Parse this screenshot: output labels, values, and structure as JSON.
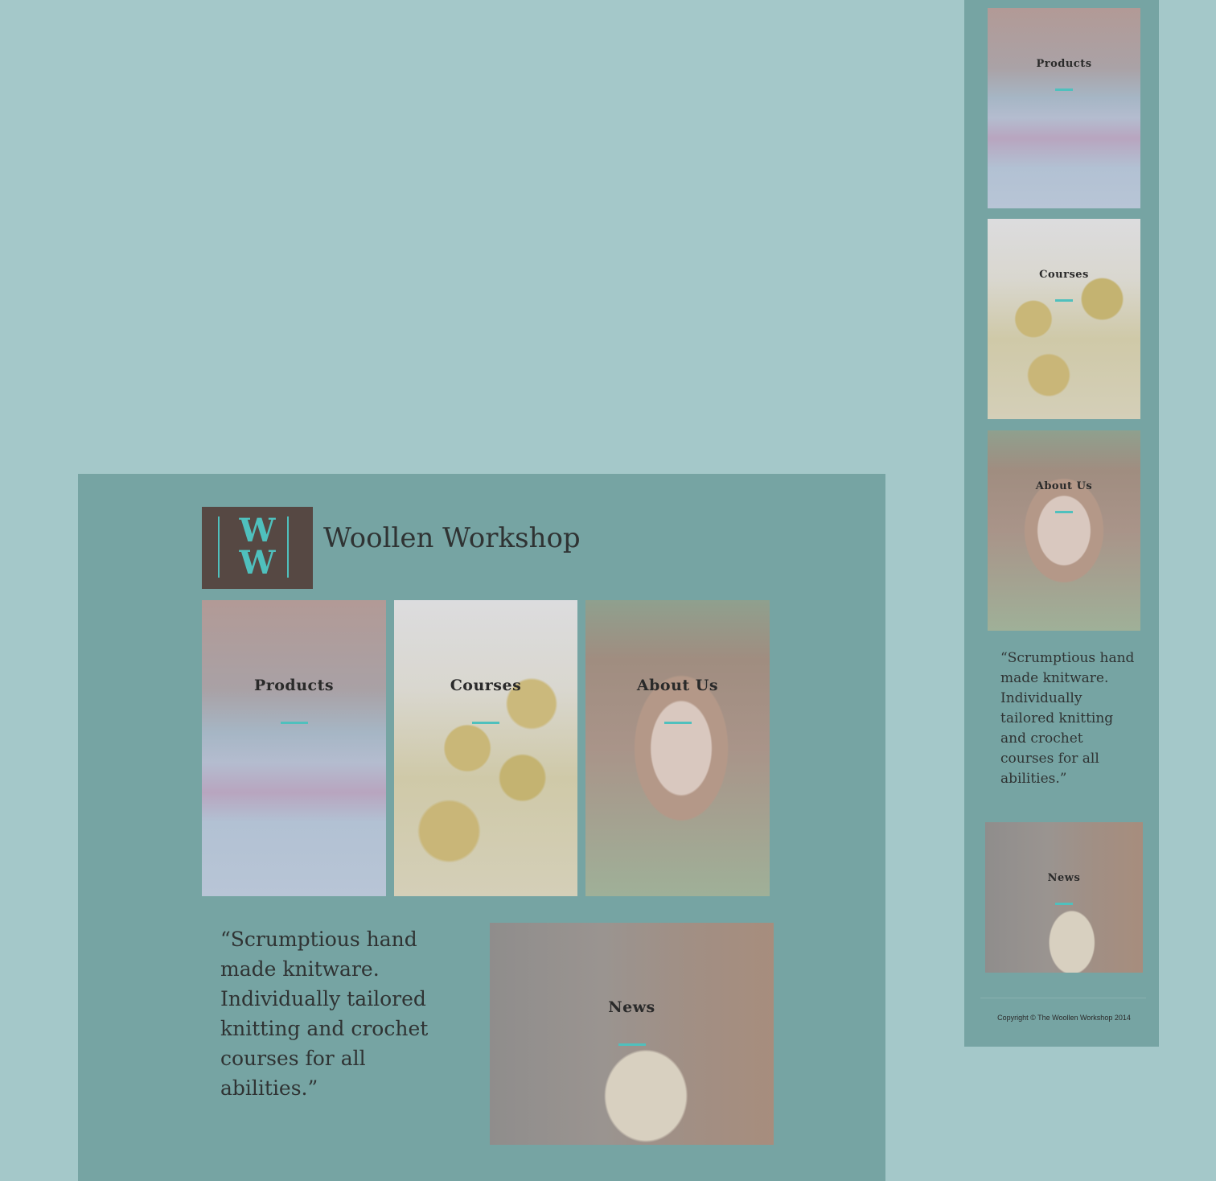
{
  "site": {
    "title": "Woollen Workshop",
    "logo_letters": [
      "W",
      "W"
    ]
  },
  "nav_tiles": [
    {
      "label": "Products"
    },
    {
      "label": "Courses"
    },
    {
      "label": "About Us"
    },
    {
      "label": "News"
    }
  ],
  "quote": "“Scrumptious hand made knitware. Individually tailored knitting and crochet courses for all abilities.”",
  "footer": {
    "copyright": "Copyright © The Woollen Workshop 2014"
  },
  "colors": {
    "page_background": "#a4c8c9",
    "panel_background": "#76a4a3",
    "logo_background": "#564843",
    "accent": "#4fc0bd",
    "text": "#2f3333"
  }
}
